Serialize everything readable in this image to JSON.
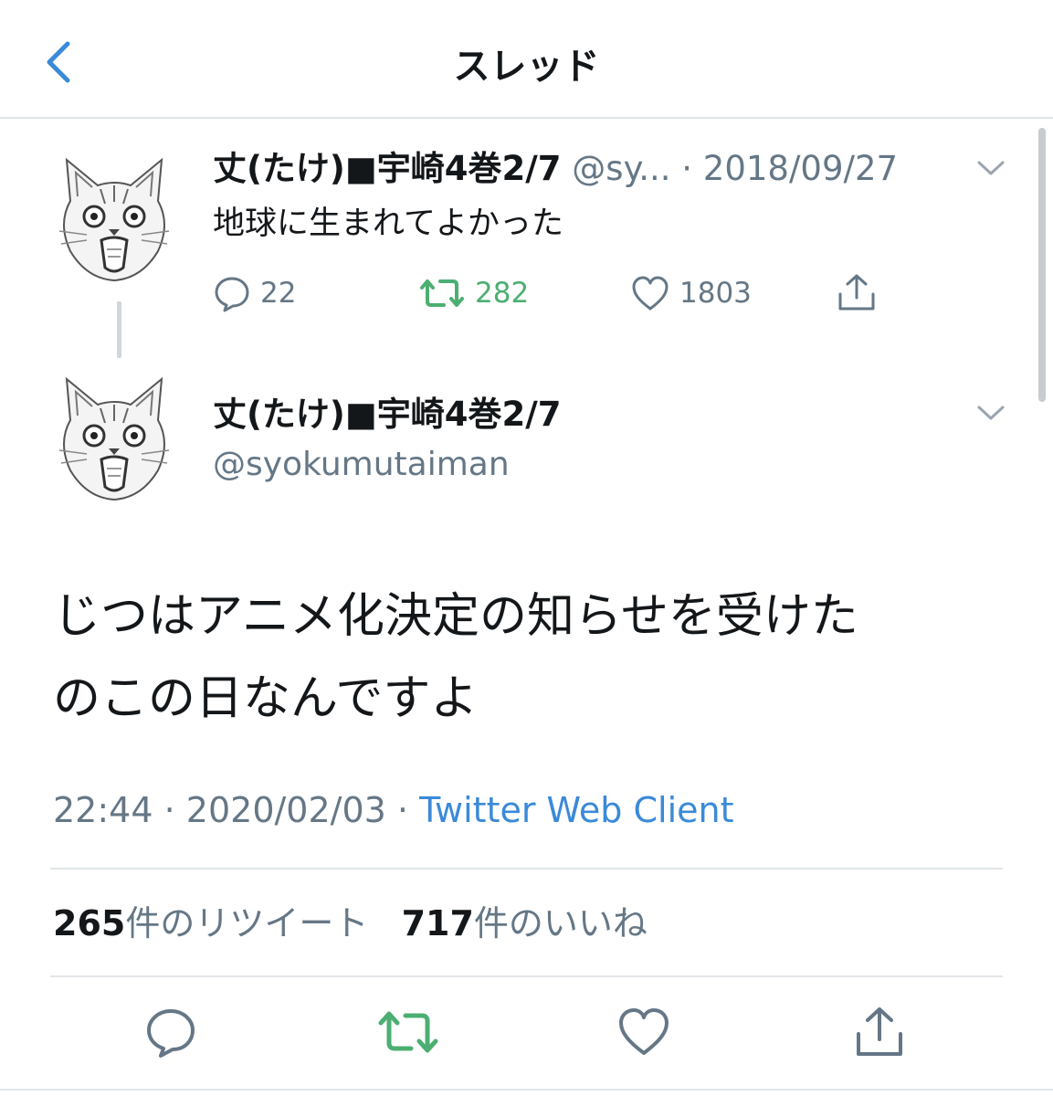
{
  "header": {
    "title": "スレッド",
    "back_icon": "chevron-left-icon",
    "accent_color": "#3a8ad8"
  },
  "thread_tweet": {
    "display_name": "丈(たけ)■宇崎4巻2/7",
    "handle_truncated": "@sy...",
    "date": "2018/09/27",
    "text": "地球に生まれてよかった",
    "actions": {
      "reply_count": "22",
      "retweet_count": "282",
      "like_count": "1803"
    }
  },
  "main_tweet": {
    "display_name": "丈(たけ)■宇崎4巻2/7",
    "handle": "@syokumutaiman",
    "text_line1": "じつはアニメ化決定の知らせを受けた",
    "text_line2": "のこの日なんですよ",
    "time": "22:44",
    "date": "2020/02/03",
    "source": "Twitter Web Client",
    "stats": {
      "retweets_count": "265",
      "retweets_label": "件のリツイート",
      "likes_count": "717",
      "likes_label": "件のいいね"
    }
  },
  "colors": {
    "retweet_green": "#4caf72",
    "meta_gray": "#657786",
    "link_blue": "#3a8ad8"
  }
}
